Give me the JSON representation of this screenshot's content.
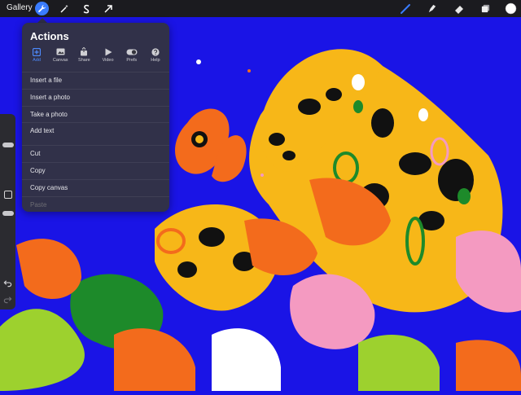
{
  "toolbar": {
    "gallery_label": "Gallery",
    "left_tools": [
      "wrench-icon",
      "magic-wand-icon",
      "selection-s-icon",
      "transform-arrow-icon"
    ],
    "right_tools": [
      "brush-icon",
      "smudge-icon",
      "eraser-icon",
      "layers-icon",
      "color-swatch-icon"
    ],
    "accent_color": "#3a7cff",
    "current_color": "#ffffff"
  },
  "actions_panel": {
    "title": "Actions",
    "tabs": [
      {
        "label": "Add",
        "icon": "add-icon",
        "active": true
      },
      {
        "label": "Canvas",
        "icon": "canvas-icon",
        "active": false
      },
      {
        "label": "Share",
        "icon": "share-icon",
        "active": false
      },
      {
        "label": "Video",
        "icon": "video-play-icon",
        "active": false
      },
      {
        "label": "Prefs",
        "icon": "toggle-icon",
        "active": false
      },
      {
        "label": "Help",
        "icon": "help-icon",
        "active": false
      }
    ],
    "group1": [
      "Insert a file",
      "Insert a photo",
      "Take a photo",
      "Add text"
    ],
    "group2": [
      "Cut",
      "Copy",
      "Copy canvas"
    ],
    "disabled_item": "Paste"
  },
  "canvas": {
    "background_color": "#1a14e6"
  }
}
